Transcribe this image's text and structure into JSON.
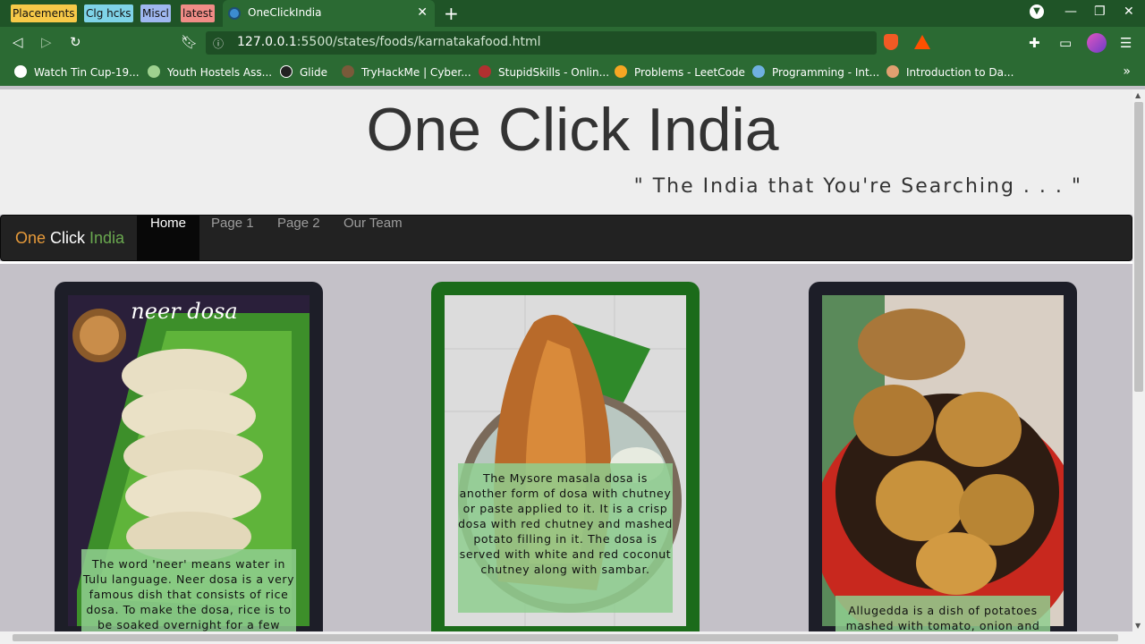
{
  "browser": {
    "pinned_tabs": [
      {
        "label": "Placements",
        "color": "#f7c948"
      },
      {
        "label": "Clg hcks",
        "color": "#7fd3e8"
      },
      {
        "label": "Miscl",
        "color": "#9fb7f0"
      },
      {
        "label": "latest",
        "color": "#f08c86"
      }
    ],
    "active_tab": {
      "title": "OneClickIndia"
    },
    "address": {
      "host": "127.0.0.1",
      "path": ":5500/states/foods/karnatakafood.html"
    },
    "bookmarks": [
      {
        "label": "Watch Tin Cup-19...",
        "icon_color": "#ffffff"
      },
      {
        "label": "Youth Hostels Ass...",
        "icon_color": "#9ed18f"
      },
      {
        "label": "Glide",
        "icon_color": "#222222"
      },
      {
        "label": "TryHackMe | Cyber...",
        "icon_color": "#7a5a3a"
      },
      {
        "label": "StupidSkills - Onlin...",
        "icon_color": "#b03030"
      },
      {
        "label": "Problems - LeetCode",
        "icon_color": "#f5a623"
      },
      {
        "label": "Programming - Int...",
        "icon_color": "#6fb0e0"
      },
      {
        "label": "Introduction to Da...",
        "icon_color": "#e0a070"
      }
    ]
  },
  "site": {
    "title": "One Click India",
    "tagline": "\" The India that You're Searching . . . \"",
    "brand": {
      "part1": "One ",
      "part2": "Click ",
      "part3": "India"
    },
    "nav": [
      {
        "label": "Home",
        "active": true
      },
      {
        "label": "Page 1",
        "active": false
      },
      {
        "label": "Page 2",
        "active": false
      },
      {
        "label": "Our Team",
        "active": false
      }
    ]
  },
  "cards": [
    {
      "image_label": "neer dosa",
      "caption": "The word 'neer' means water in Tulu language. Neer dosa is a very famous dish that consists of rice dosa. To make the dosa, rice is to be soaked overnight for a few",
      "frame_color": "#1d1e28"
    },
    {
      "image_label": "",
      "caption": "The Mysore masala dosa is another form of dosa with chutney or paste applied to it. It is a crisp dosa with red chutney and mashed potato filling in it. The dosa is served with white and red coconut chutney along with sambar.",
      "frame_color": "#1b6b1a"
    },
    {
      "image_label": "",
      "caption": "Allugedda is a dish of potatoes mashed with tomato, onion and",
      "frame_color": "#1d1e28"
    }
  ]
}
